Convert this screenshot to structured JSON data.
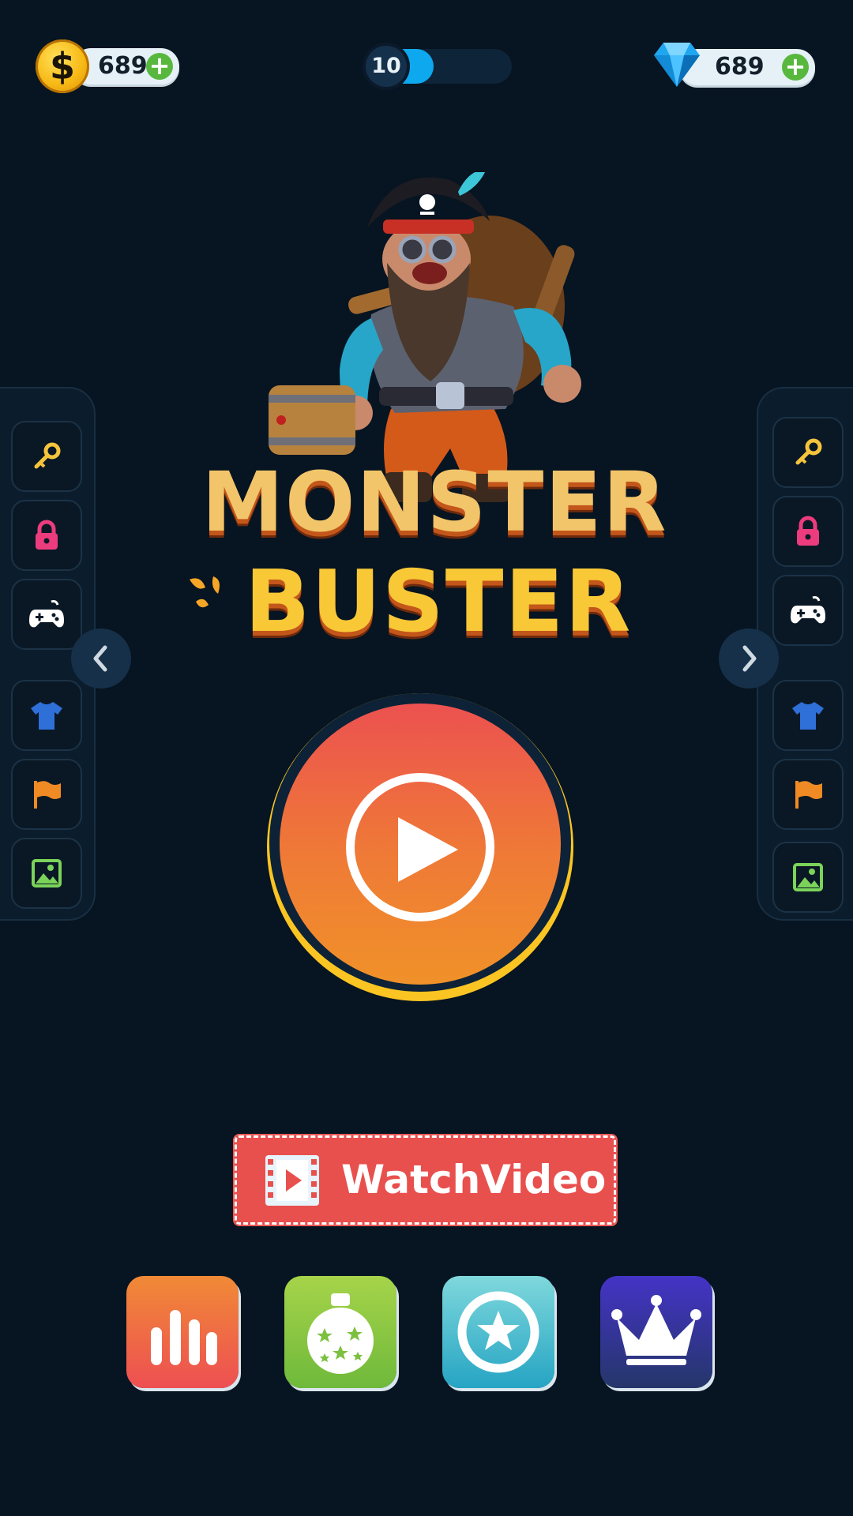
{
  "top_bar": {
    "coins": {
      "value": "689",
      "icon": "dollar-coin-icon",
      "coin_symbol": "$"
    },
    "level": {
      "value": "10",
      "progress": 0.4
    },
    "gems": {
      "value": "689",
      "icon": "diamond-icon"
    },
    "add_symbol": "+"
  },
  "title": {
    "line1": "MONSTER",
    "line2": "BUSTER"
  },
  "left_panel": {
    "items": [
      {
        "icon": "key-icon",
        "color": "#f5c43c"
      },
      {
        "icon": "lock-icon",
        "color": "#ec3c7e"
      },
      {
        "icon": "gamepad-icon",
        "color": "#ffffff"
      },
      {
        "icon": "tshirt-icon",
        "color": "#2f6fd8"
      },
      {
        "icon": "flag-icon",
        "color": "#f08a24"
      },
      {
        "icon": "image-icon",
        "color": "#7bd35a"
      }
    ]
  },
  "right_panel": {
    "items": [
      {
        "icon": "key-icon",
        "color": "#f5c43c"
      },
      {
        "icon": "lock-icon",
        "color": "#ec3c7e"
      },
      {
        "icon": "gamepad-icon",
        "color": "#ffffff"
      },
      {
        "icon": "tshirt-icon",
        "color": "#2f6fd8"
      },
      {
        "icon": "flag-icon",
        "color": "#f08a24"
      },
      {
        "icon": "image-icon",
        "color": "#7bd35a"
      }
    ]
  },
  "play_button": {
    "icon": "play-icon"
  },
  "watch_video": {
    "label": "WatchVideo",
    "icon": "film-icon"
  },
  "bottom_buttons": [
    {
      "icon": "leaderboard-icon",
      "color": "#f05a4e"
    },
    {
      "icon": "ornament-icon",
      "color": "#8cc43c"
    },
    {
      "icon": "star-badge-icon",
      "color": "#34b4c8"
    },
    {
      "icon": "crown-icon",
      "color": "#3a2ea8"
    }
  ],
  "colors": {
    "background": "#071421",
    "play_gradient_top": "#ec5150",
    "play_gradient_bottom": "#f09129",
    "title_gold": "#f8c836",
    "accent_blue": "#0ea8ee"
  }
}
